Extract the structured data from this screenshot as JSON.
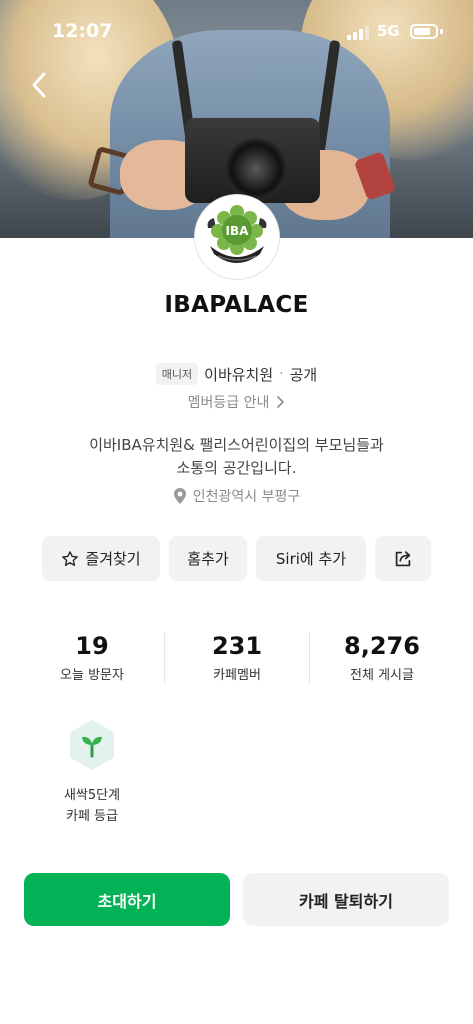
{
  "status_bar": {
    "time": "12:07",
    "network": "5G",
    "battery_level": 0.8
  },
  "colors": {
    "accent_green": "#03b256",
    "button_gray": "#f1f2f4",
    "muted_text": "#8c8c8c"
  },
  "header": {
    "back_icon": "chevron-left-icon",
    "cover_image": "camera-photo"
  },
  "cafe": {
    "avatar_logo": "IBA kindergarten emblem",
    "title": "IBAPALACE",
    "role_badge": "매니저",
    "manager_name": "이바유치원",
    "separator": "·",
    "visibility": "공개",
    "grade_link": "멤버등급 안내",
    "description_line1": "이바IBA유치원& 팰리스어린이집의 부모님들과",
    "description_line2": "소통의 공간입니다.",
    "location": "인천광역시 부평구"
  },
  "actions": {
    "favorite_label": "즐겨찾기",
    "home_add_label": "홈추가",
    "siri_label": "Siri에 추가",
    "share_icon": "share-icon"
  },
  "stats": {
    "visitors_today": "19",
    "visitors_label": "오늘 방문자",
    "members": "231",
    "members_label": "카페멤버",
    "posts": "8,276",
    "posts_label": "전체 게시글"
  },
  "level": {
    "icon": "sprout-icon",
    "name": "새싹5단계",
    "caption": "카페 등급"
  },
  "bottom": {
    "invite_label": "초대하기",
    "leave_label": "카페 탈퇴하기"
  }
}
